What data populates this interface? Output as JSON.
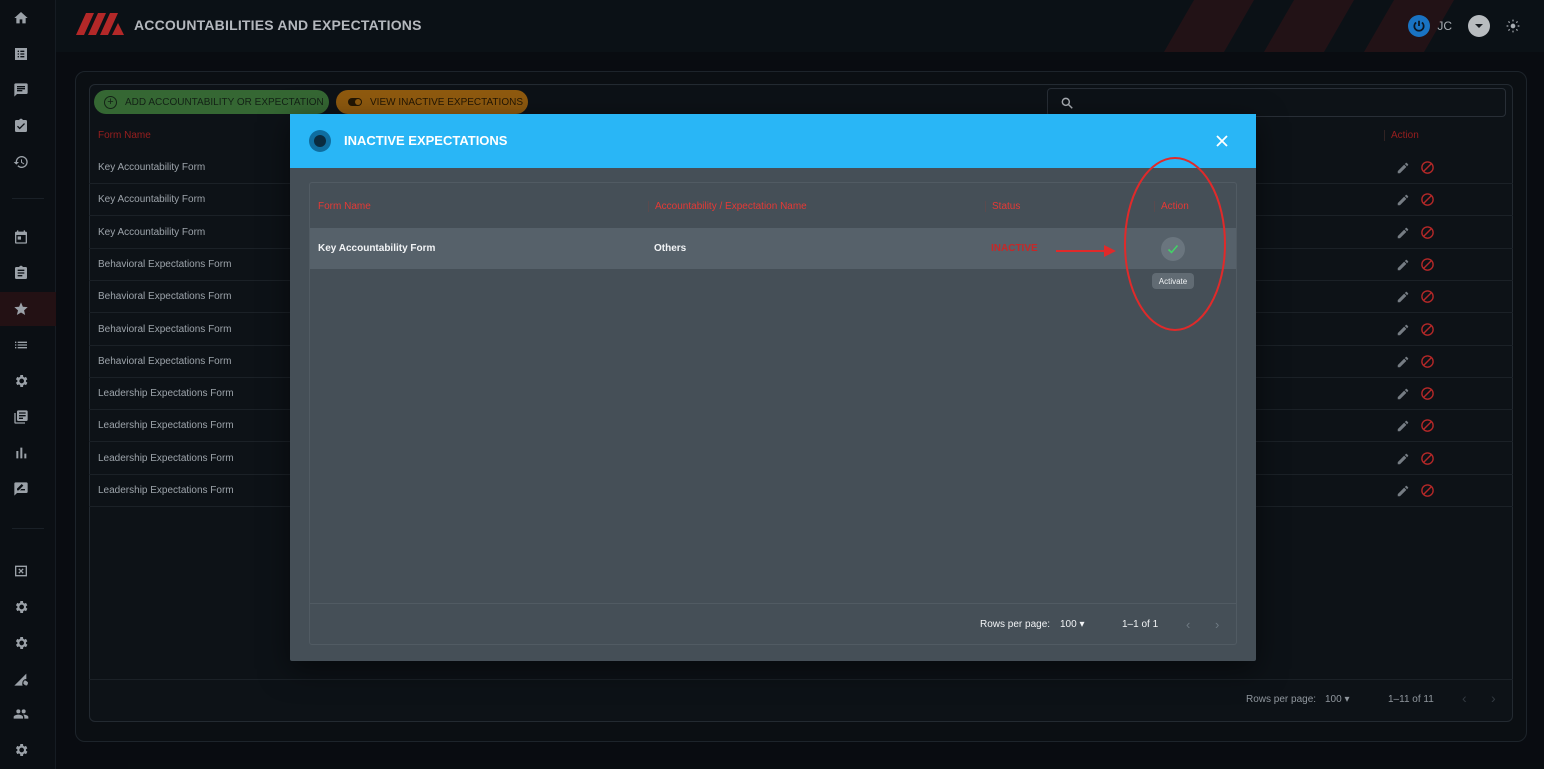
{
  "header": {
    "page_title": "ACCOUNTABILITIES AND EXPECTATIONS",
    "user_initials": "JC"
  },
  "toolbar": {
    "add_label": "ADD ACCOUNTABILITY OR EXPECTATION",
    "view_inactive_label": "VIEW INACTIVE EXPECTATIONS",
    "search_value": ""
  },
  "table": {
    "headers": {
      "form_name": "Form Name",
      "action": "Action"
    },
    "rows": [
      "Key Accountability Form",
      "Key Accountability Form",
      "Key Accountability Form",
      "Behavioral Expectations Form",
      "Behavioral Expectations Form",
      "Behavioral Expectations Form",
      "Behavioral Expectations Form",
      "Leadership Expectations Form",
      "Leadership Expectations Form",
      "Leadership Expectations Form",
      "Leadership Expectations Form"
    ],
    "footer": {
      "rows_per_page_label": "Rows per page:",
      "rows_per_page_value": "100",
      "range": "1–11 of 11"
    }
  },
  "modal": {
    "title": "INACTIVE EXPECTATIONS",
    "headers": {
      "form_name": "Form Name",
      "expectation_name": "Accountability / Expectation Name",
      "status": "Status",
      "action": "Action"
    },
    "row": {
      "form_name": "Key Accountability Form",
      "expectation_name": "Others",
      "status": "INACTIVE"
    },
    "tooltip": "Activate",
    "footer": {
      "rows_per_page_label": "Rows per page:",
      "rows_per_page_value": "100",
      "range": "1–1 of 1"
    }
  },
  "colors": {
    "modal_header": "#29b6f6",
    "accent_red": "#e53935",
    "add_button": "#3f7a3c",
    "inactive_button": "#a86a12",
    "success_check": "#43d167"
  },
  "icons": {
    "rail": [
      "home-icon",
      "list-alt-icon",
      "feedback-icon",
      "assignment-turned-in-icon",
      "history-icon",
      "calendar-icon",
      "clipboard-icon",
      "star-icon",
      "list-icon",
      "settings-icon",
      "library-icon",
      "bar-chart-icon",
      "rate-review-icon",
      "cancel-box-icon",
      "settings-icon",
      "settings-icon",
      "signal-settings-icon",
      "people-icon",
      "settings-icon"
    ]
  }
}
